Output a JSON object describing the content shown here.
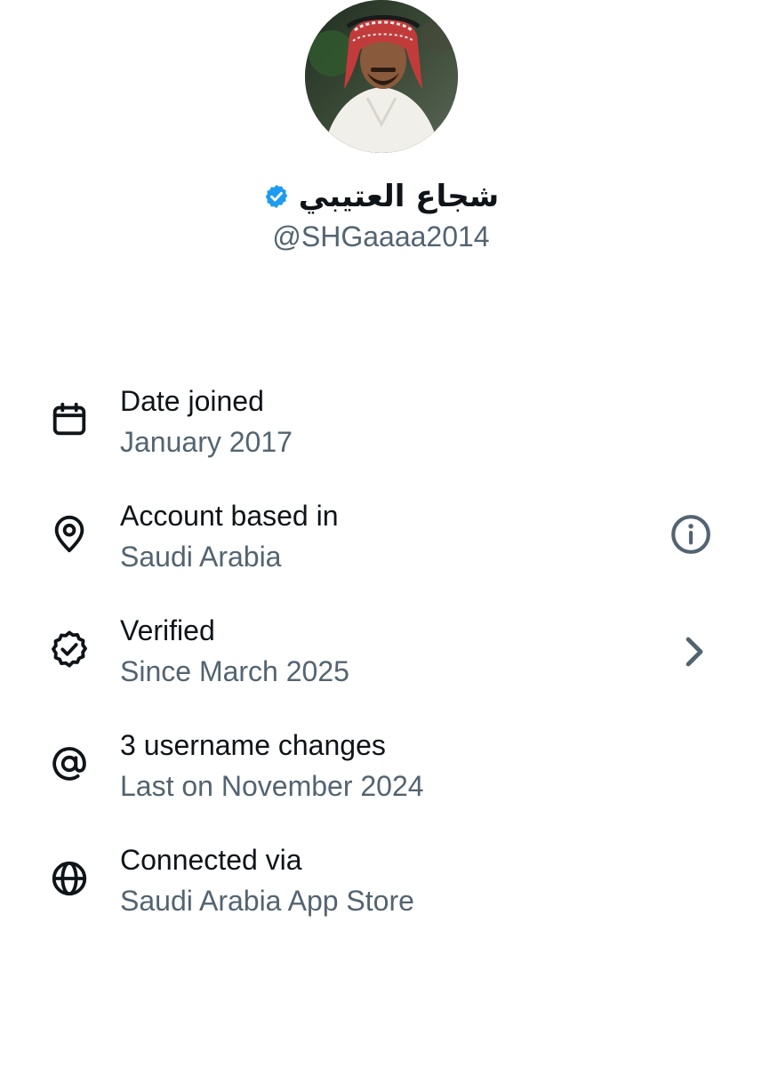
{
  "profile": {
    "display_name": "شجاع العتيبي",
    "handle": "@SHGaaaa2014",
    "verified": true,
    "avatar_icon": "profile-photo"
  },
  "about": {
    "items": [
      {
        "icon": "calendar-icon",
        "title": "Date joined",
        "subtitle": "January 2017"
      },
      {
        "icon": "location-pin-icon",
        "title": "Account based in",
        "subtitle": "Saudi Arabia",
        "trailing_icon": "info-icon"
      },
      {
        "icon": "verified-seal-icon",
        "title": "Verified",
        "subtitle": "Since March 2025",
        "trailing_icon": "chevron-right-icon"
      },
      {
        "icon": "at-sign-icon",
        "title": "3 username changes",
        "subtitle": "Last on November 2024"
      },
      {
        "icon": "globe-icon",
        "title": "Connected via",
        "subtitle": "Saudi Arabia App Store"
      }
    ]
  },
  "colors": {
    "primary_text": "#0f1419",
    "secondary_text": "#536471",
    "verified_blue": "#1d9bf0",
    "background": "#ffffff"
  }
}
